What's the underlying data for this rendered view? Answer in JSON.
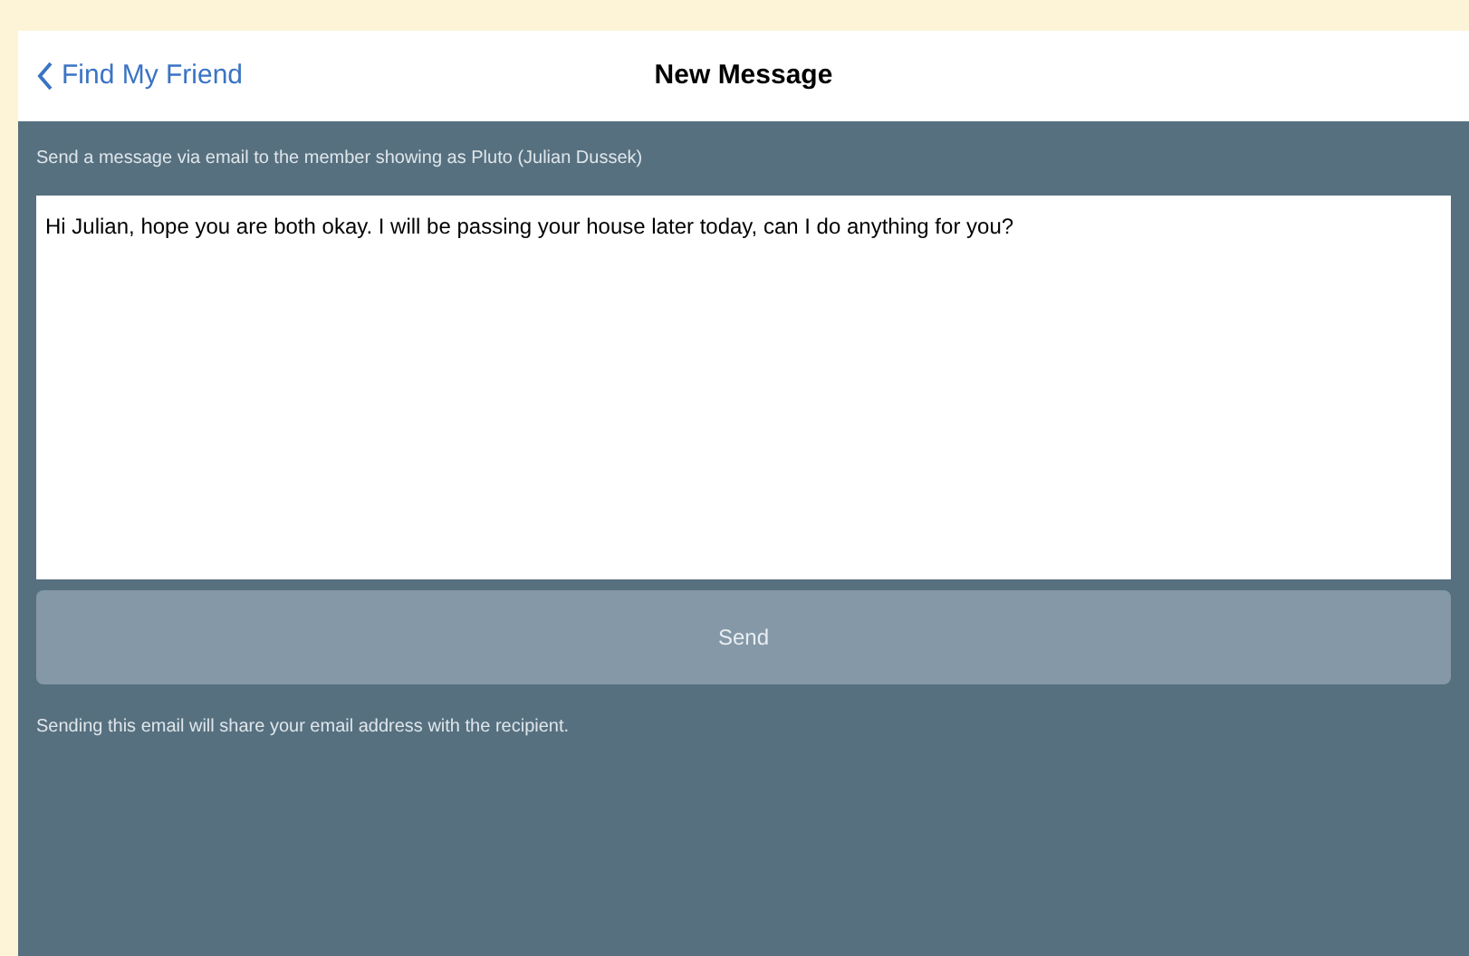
{
  "nav": {
    "back_label": "Find My Friend",
    "title": "New Message"
  },
  "intro": "Send a message via email to the member showing as Pluto (Julian Dussek)",
  "message": {
    "value": "Hi Julian, hope you are both okay. I will be passing your house later today, can I do anything for you?"
  },
  "send_button": {
    "label": "Send",
    "disabled": true
  },
  "footer_note": "Sending this email will share your email address with the recipient."
}
